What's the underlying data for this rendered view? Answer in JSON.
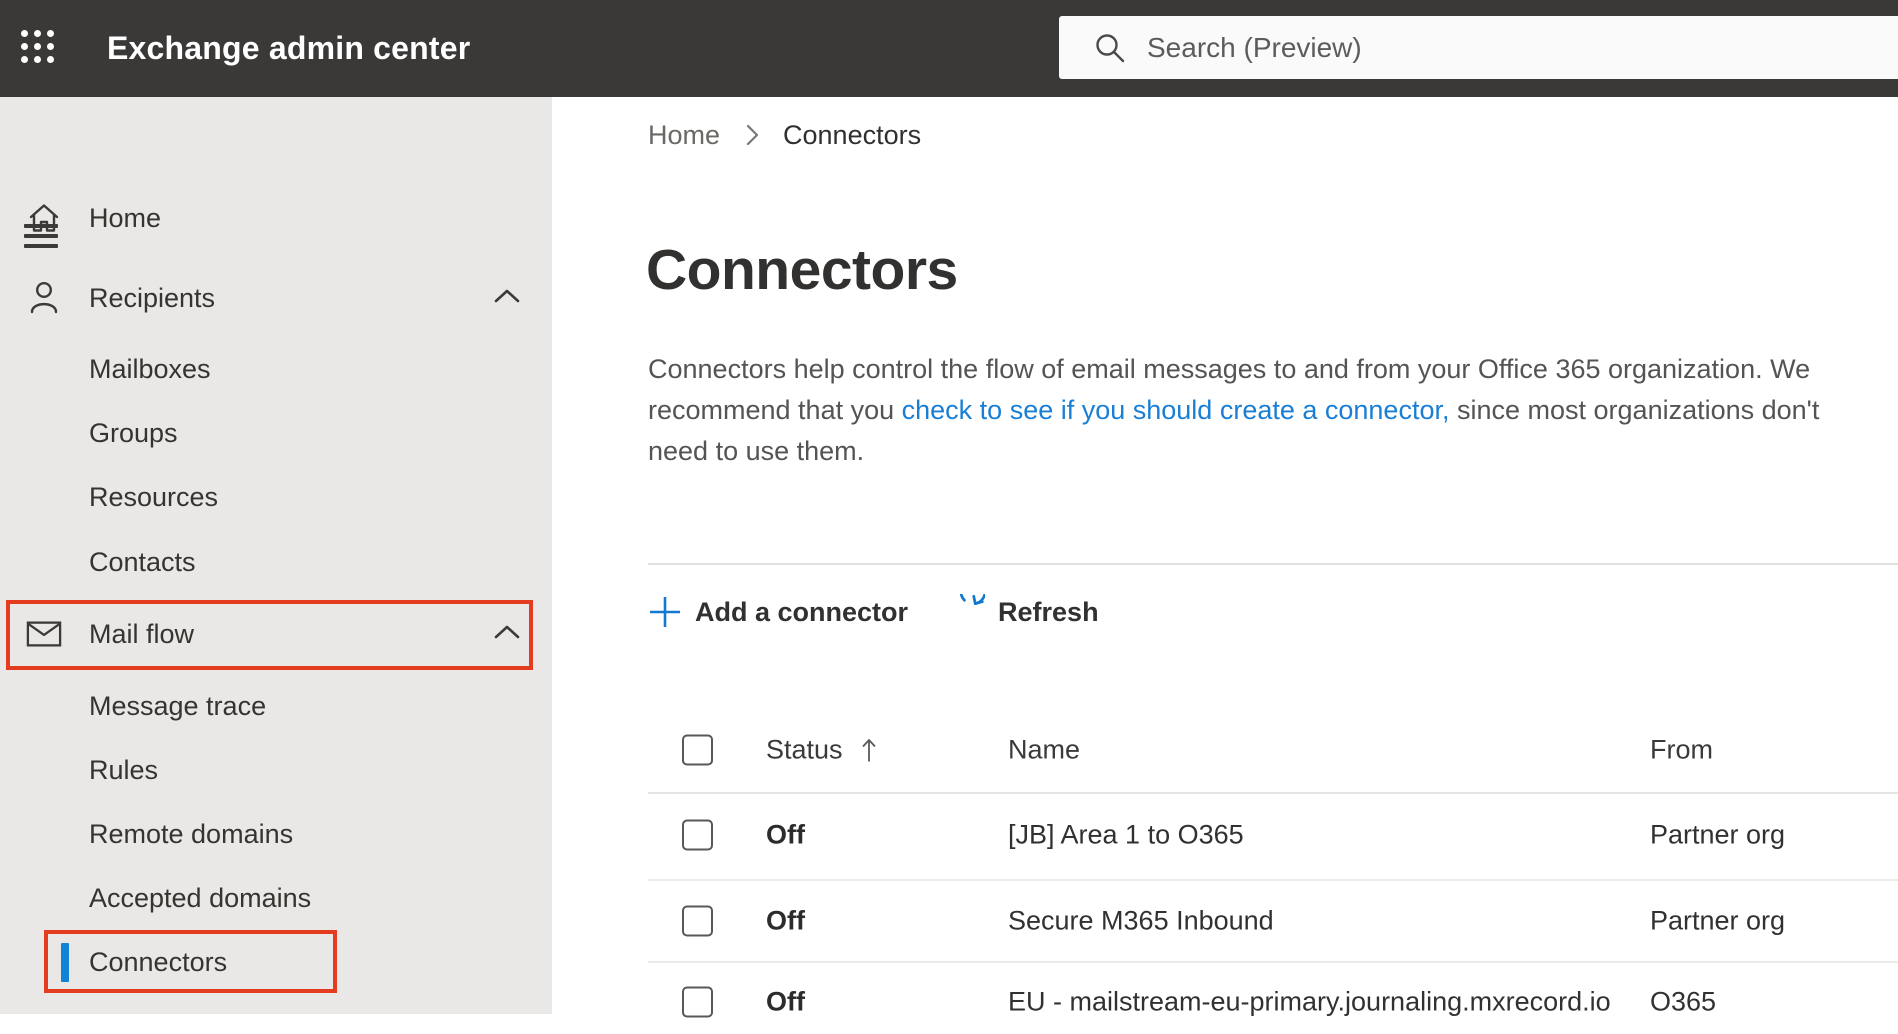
{
  "app": {
    "title": "Exchange admin center"
  },
  "search": {
    "placeholder": "Search (Preview)"
  },
  "sidebar": {
    "items": [
      {
        "label": "Home",
        "icon": "home-icon"
      },
      {
        "label": "Recipients",
        "icon": "person-icon",
        "expanded": true
      },
      {
        "label": "Mailboxes"
      },
      {
        "label": "Groups"
      },
      {
        "label": "Resources"
      },
      {
        "label": "Contacts"
      },
      {
        "label": "Mail flow",
        "icon": "mail-icon",
        "expanded": true,
        "annotated": true
      },
      {
        "label": "Message trace"
      },
      {
        "label": "Rules"
      },
      {
        "label": "Remote domains"
      },
      {
        "label": "Accepted domains"
      },
      {
        "label": "Connectors",
        "selected": true,
        "annotated": true
      }
    ]
  },
  "breadcrumb": {
    "home": "Home",
    "current": "Connectors"
  },
  "page": {
    "title": "Connectors",
    "description_pre": "Connectors help control the flow of email messages to and from your Office 365 organization. We recommend that you ",
    "description_link": "check to see if you should create a connector,",
    "description_post": " since most organizations don't need to use them."
  },
  "toolbar": {
    "add_label": "Add a connector",
    "refresh_label": "Refresh"
  },
  "table": {
    "columns": {
      "status": "Status",
      "name": "Name",
      "from": "From"
    },
    "sorted_by": "Status",
    "sort_direction": "ascending",
    "rows": [
      {
        "status": "Off",
        "name": "[JB] Area 1 to O365",
        "from": "Partner org"
      },
      {
        "status": "Off",
        "name": "Secure M365 Inbound",
        "from": "Partner org"
      },
      {
        "status": "Off",
        "name": "EU - mailstream-eu-primary.journaling.mxrecord.io",
        "from": "O365"
      }
    ]
  },
  "colors": {
    "topbar": "#3a3938",
    "sidebar_bg": "#e9e8e6",
    "annotation_red": "#e43c1e",
    "selection_blue": "#1183d6",
    "link_blue": "#1a7fd4",
    "action_blue": "#1379d0"
  }
}
